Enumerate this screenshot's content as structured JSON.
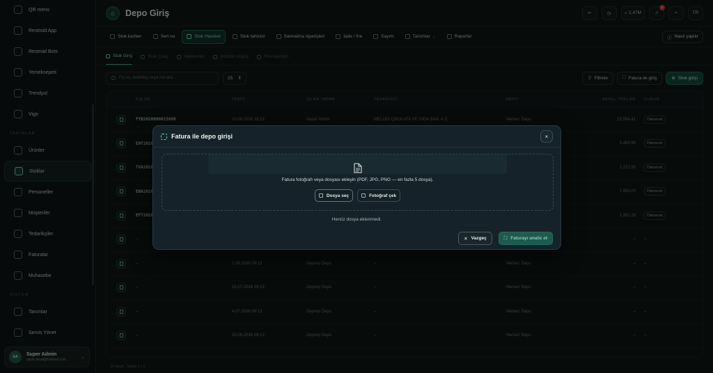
{
  "sidebar": {
    "items_top": [
      {
        "label": "QR menü"
      },
      {
        "label": "Restroid App"
      },
      {
        "label": "Restroid Bots"
      },
      {
        "label": "Yemeksepeti"
      },
      {
        "label": "Trendyol"
      },
      {
        "label": "Vigo"
      }
    ],
    "section_tanim": "TANIMLAR",
    "items_tanim": [
      {
        "label": "Ürünler"
      },
      {
        "label": "Stoklar",
        "active": true
      },
      {
        "label": "Personeller"
      },
      {
        "label": "Müşteriler"
      },
      {
        "label": "Tedarikçiler"
      },
      {
        "label": "Faturalar"
      },
      {
        "label": "Muhasebe"
      }
    ],
    "section_sistem": "SİSTEM",
    "items_sistem": [
      {
        "label": "Tanımlar"
      },
      {
        "label": "Servis Yönet"
      }
    ],
    "user": {
      "initials": "SA",
      "name": "Super Admin",
      "email": "yasin.aksal@hotmail.com"
    }
  },
  "header": {
    "title": "Depo Giriş",
    "balance": "2,47M",
    "notif_count": "3",
    "lang": "TR"
  },
  "modules": [
    {
      "label": "Stok kartları"
    },
    {
      "label": "Seri no"
    },
    {
      "label": "Stok Hareket",
      "active": true
    },
    {
      "label": "Stok tahmini"
    },
    {
      "label": "Satınalma siparişleri"
    },
    {
      "label": "İade / fire"
    },
    {
      "label": "Sayım"
    },
    {
      "label": "Tanımlar",
      "dropdown": true
    },
    {
      "label": "Raporlar"
    }
  ],
  "help_label": "Nasıl yapılır",
  "subtabs": [
    {
      "label": "Stok Giriş",
      "active": true
    },
    {
      "label": "Stok Çıkış"
    },
    {
      "label": "Hareketler"
    },
    {
      "label": "Stoktan düşüş"
    },
    {
      "label": "Fire kayıtları"
    }
  ],
  "filters": {
    "search_placeholder": "Fiş no, tedarikçi veya not ara...",
    "page_size": "25",
    "filter_label": "Filtrele",
    "invoice_label": "Fatura ile giriş",
    "add_label": "Stok girişi"
  },
  "table": {
    "headers": [
      "FİŞ NO",
      "TARİH",
      "İŞLEM YAPAN",
      "TEDARİKÇİ",
      "DEPO",
      "GENEL TOPLAM",
      "DURUM"
    ],
    "rows": [
      {
        "fis": "FYB2020000015088",
        "tarih": "23.06.2026 18:13",
        "islem": "Super Admin",
        "ted": "MELODİ ÇİKOLATA VE GIDA SAN. A.Ş.",
        "depo": "Merkez Depo",
        "toplam": "23.554,41",
        "durum": "Ödenecek"
      },
      {
        "fis": "EHT2020000015087",
        "tarih": "",
        "islem": "",
        "ted": "",
        "depo": "",
        "toplam": "5.469,66",
        "durum": "Ödenecek"
      },
      {
        "fis": "TVA2020000015086",
        "tarih": "",
        "islem": "",
        "ted": "",
        "depo": "",
        "toplam": "2.272,50",
        "durum": "Ödenecek"
      },
      {
        "fis": "ENA2020000015085",
        "tarih": "",
        "islem": "",
        "ted": "",
        "depo": "",
        "toplam": "7.950,00",
        "durum": "Ödenecek"
      },
      {
        "fis": "EFT2020000015084",
        "tarih": "",
        "islem": "",
        "ted": "",
        "depo": "",
        "toplam": "1.301,28",
        "durum": "Ödenecek"
      },
      {
        "fis": "–",
        "tarih": "",
        "islem": "",
        "ted": "",
        "depo": "",
        "toplam": "–",
        "durum": "–"
      },
      {
        "fis": "–",
        "tarih": "1.08.2026 09:13",
        "islem": "Zeynep Depo",
        "ted": "–",
        "depo": "Merkez Depo",
        "toplam": "–",
        "durum": "–"
      },
      {
        "fis": "–",
        "tarih": "15.07.2026 09:13",
        "islem": "Zeynep Depo",
        "ted": "–",
        "depo": "Merkez Depo",
        "toplam": "–",
        "durum": "–"
      },
      {
        "fis": "–",
        "tarih": "4.07.2026 09:13",
        "islem": "Zeynep Depo",
        "ted": "–",
        "depo": "Merkez Depo",
        "toplam": "–",
        "durum": "–"
      },
      {
        "fis": "–",
        "tarih": "15.06.2026 09:13",
        "islem": "Zeynep Depo",
        "ted": "–",
        "depo": "Merkez Depo",
        "toplam": "–",
        "durum": "–"
      }
    ],
    "footer": "10 kayıt · Sayfa 1 / 1"
  },
  "modal": {
    "title": "Fatura ile depo girişi",
    "drop_text": "Fatura fotoğrafı veya dosyası ekleyin (PDF, JPG, PNG — en fazla 5 dosya).",
    "choose_file": "Dosya seç",
    "take_photo": "Fotoğraf çek",
    "empty": "Henüz dosya eklenmedi.",
    "cancel": "Vazgeç",
    "analyze": "Faturayı analiz et"
  }
}
